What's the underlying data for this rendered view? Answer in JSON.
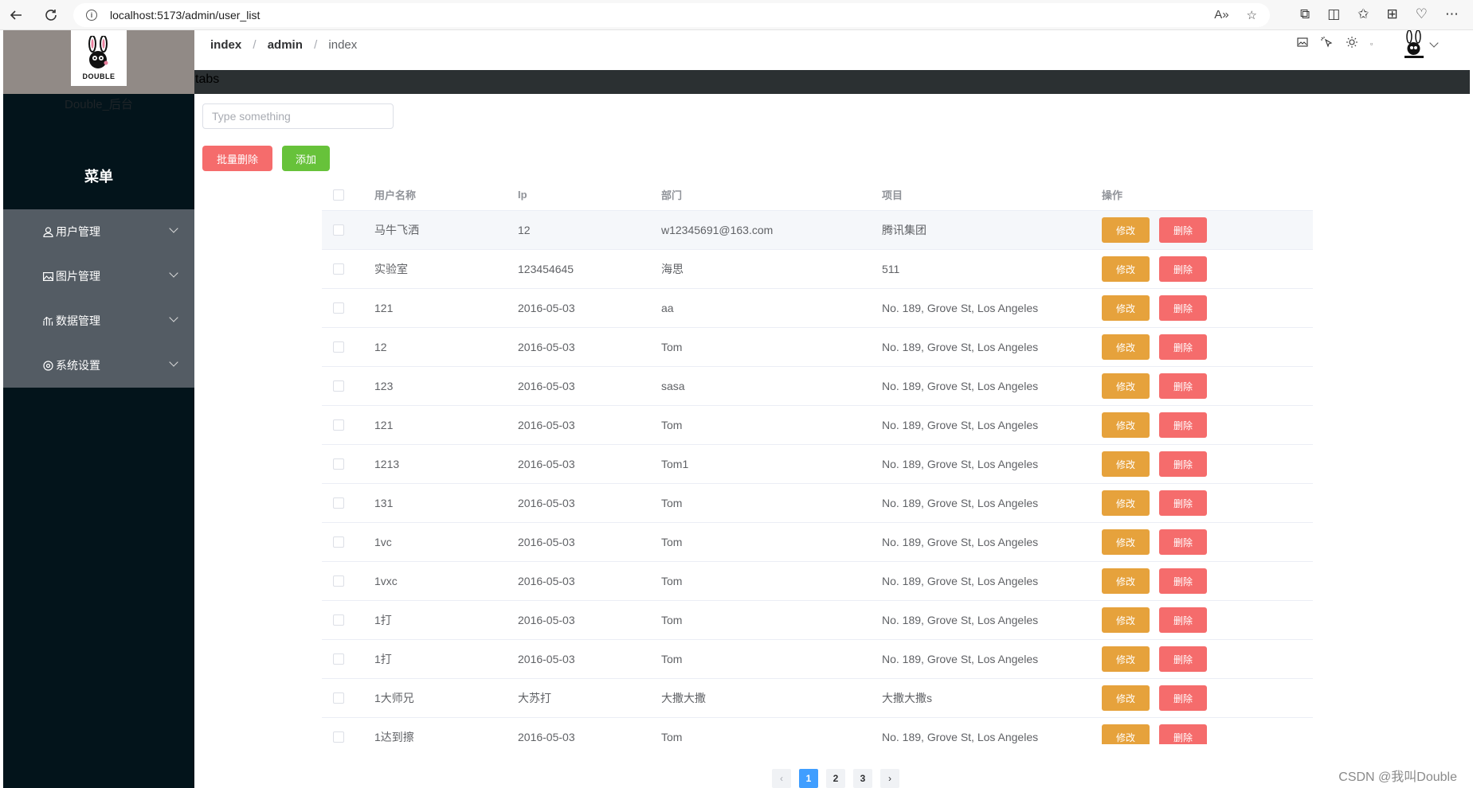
{
  "browser": {
    "url": "localhost:5173/admin/user_list"
  },
  "sidebar": {
    "logo_text": "DOUBLE",
    "site_name": "Double_后台",
    "menu_title": "菜单",
    "items": [
      {
        "icon": "user-icon",
        "label": "用户管理"
      },
      {
        "icon": "picture-icon",
        "label": "图片管理"
      },
      {
        "icon": "chart-icon",
        "label": "数据管理"
      },
      {
        "icon": "settings-icon",
        "label": "系统设置"
      }
    ]
  },
  "header": {
    "breadcrumb": [
      "index",
      "admin",
      "index"
    ],
    "tabs_label": "tabs"
  },
  "search": {
    "placeholder": "Type something"
  },
  "toolbar": {
    "batch_delete": "批量删除",
    "add": "添加"
  },
  "table": {
    "headers": [
      "用户名称",
      "Ip",
      "部门",
      "项目",
      "操作"
    ],
    "edit_label": "修改",
    "delete_label": "删除",
    "rows": [
      {
        "name": "马牛飞洒",
        "ip": "12",
        "dept": "w12345691@163.com",
        "project": "腾讯集团"
      },
      {
        "name": "实验室",
        "ip": "123454645",
        "dept": "海思",
        "project": "511"
      },
      {
        "name": "121",
        "ip": "2016-05-03",
        "dept": "aa",
        "project": "No. 189, Grove St, Los Angeles"
      },
      {
        "name": "12",
        "ip": "2016-05-03",
        "dept": "Tom",
        "project": "No. 189, Grove St, Los Angeles"
      },
      {
        "name": "123",
        "ip": "2016-05-03",
        "dept": "sasa",
        "project": "No. 189, Grove St, Los Angeles"
      },
      {
        "name": "121",
        "ip": "2016-05-03",
        "dept": "Tom",
        "project": "No. 189, Grove St, Los Angeles"
      },
      {
        "name": "1213",
        "ip": "2016-05-03",
        "dept": "Tom1",
        "project": "No. 189, Grove St, Los Angeles"
      },
      {
        "name": "131",
        "ip": "2016-05-03",
        "dept": "Tom",
        "project": "No. 189, Grove St, Los Angeles"
      },
      {
        "name": "1vc",
        "ip": "2016-05-03",
        "dept": "Tom",
        "project": "No. 189, Grove St, Los Angeles"
      },
      {
        "name": "1vxc",
        "ip": "2016-05-03",
        "dept": "Tom",
        "project": "No. 189, Grove St, Los Angeles"
      },
      {
        "name": "1打",
        "ip": "2016-05-03",
        "dept": "Tom",
        "project": "No. 189, Grove St, Los Angeles"
      },
      {
        "name": "1打",
        "ip": "2016-05-03",
        "dept": "Tom",
        "project": "No. 189, Grove St, Los Angeles"
      },
      {
        "name": "1大师兄",
        "ip": "大苏打",
        "dept": "大撒大撒",
        "project": "大撒大撒s"
      },
      {
        "name": "1达到擦",
        "ip": "2016-05-03",
        "dept": "Tom",
        "project": "No. 189, Grove St, Los Angeles"
      }
    ]
  },
  "pagination": {
    "pages": [
      "1",
      "2",
      "3"
    ],
    "current": "1"
  },
  "watermark": "CSDN @我叫Double",
  "colors": {
    "sidebar_bg": "#03141b",
    "menu_bg": "#545c64",
    "primary": "#409eff",
    "danger": "#f56c6c",
    "warning": "#e6a23c",
    "success": "#67c23a"
  }
}
